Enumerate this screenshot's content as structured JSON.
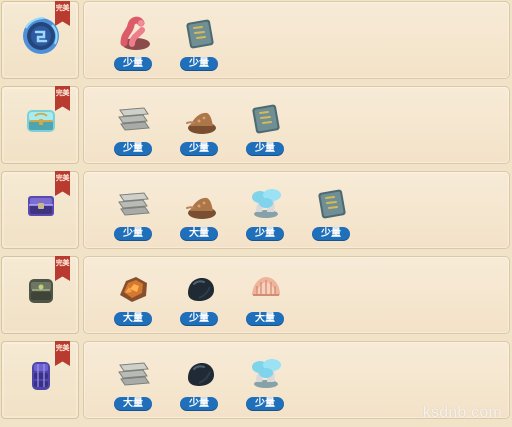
{
  "rows": [
    {
      "badge": "完美",
      "main": {
        "icon": "blue-rune-stone-icon"
      },
      "items": [
        {
          "icon": "red-worm-icon",
          "label": "少量"
        },
        {
          "icon": "tablet-stone-icon",
          "label": "少量"
        }
      ]
    },
    {
      "badge": "完美",
      "main": {
        "icon": "treasure-chest-icon"
      },
      "items": [
        {
          "icon": "stone-slabs-icon",
          "label": "少量"
        },
        {
          "icon": "dirt-pile-icon",
          "label": "少量"
        },
        {
          "icon": "tablet-stone-icon",
          "label": "少量"
        }
      ]
    },
    {
      "badge": "完美",
      "main": {
        "icon": "purple-chest-icon"
      },
      "items": [
        {
          "icon": "stone-slabs-icon",
          "label": "少量"
        },
        {
          "icon": "dirt-pile-icon",
          "label": "大量"
        },
        {
          "icon": "blue-mushroom-icon",
          "label": "少量"
        },
        {
          "icon": "tablet-stone-icon",
          "label": "少量"
        }
      ]
    },
    {
      "badge": "完美",
      "main": {
        "icon": "armor-piece-icon"
      },
      "items": [
        {
          "icon": "orange-ore-icon",
          "label": "大量"
        },
        {
          "icon": "black-coal-icon",
          "label": "少量"
        },
        {
          "icon": "seashell-icon",
          "label": "大量"
        }
      ]
    },
    {
      "badge": "完美",
      "main": {
        "icon": "purple-armor-icon"
      },
      "items": [
        {
          "icon": "stone-slabs-icon",
          "label": "大量"
        },
        {
          "icon": "black-coal-icon",
          "label": "少量"
        },
        {
          "icon": "blue-mushroom-icon",
          "label": "少量"
        }
      ]
    }
  ],
  "watermark": "ksdnb.com",
  "colors": {
    "quantity_pill": "#1f6fba",
    "badge": "#b93a2e",
    "panel": "#f4e5cc"
  }
}
